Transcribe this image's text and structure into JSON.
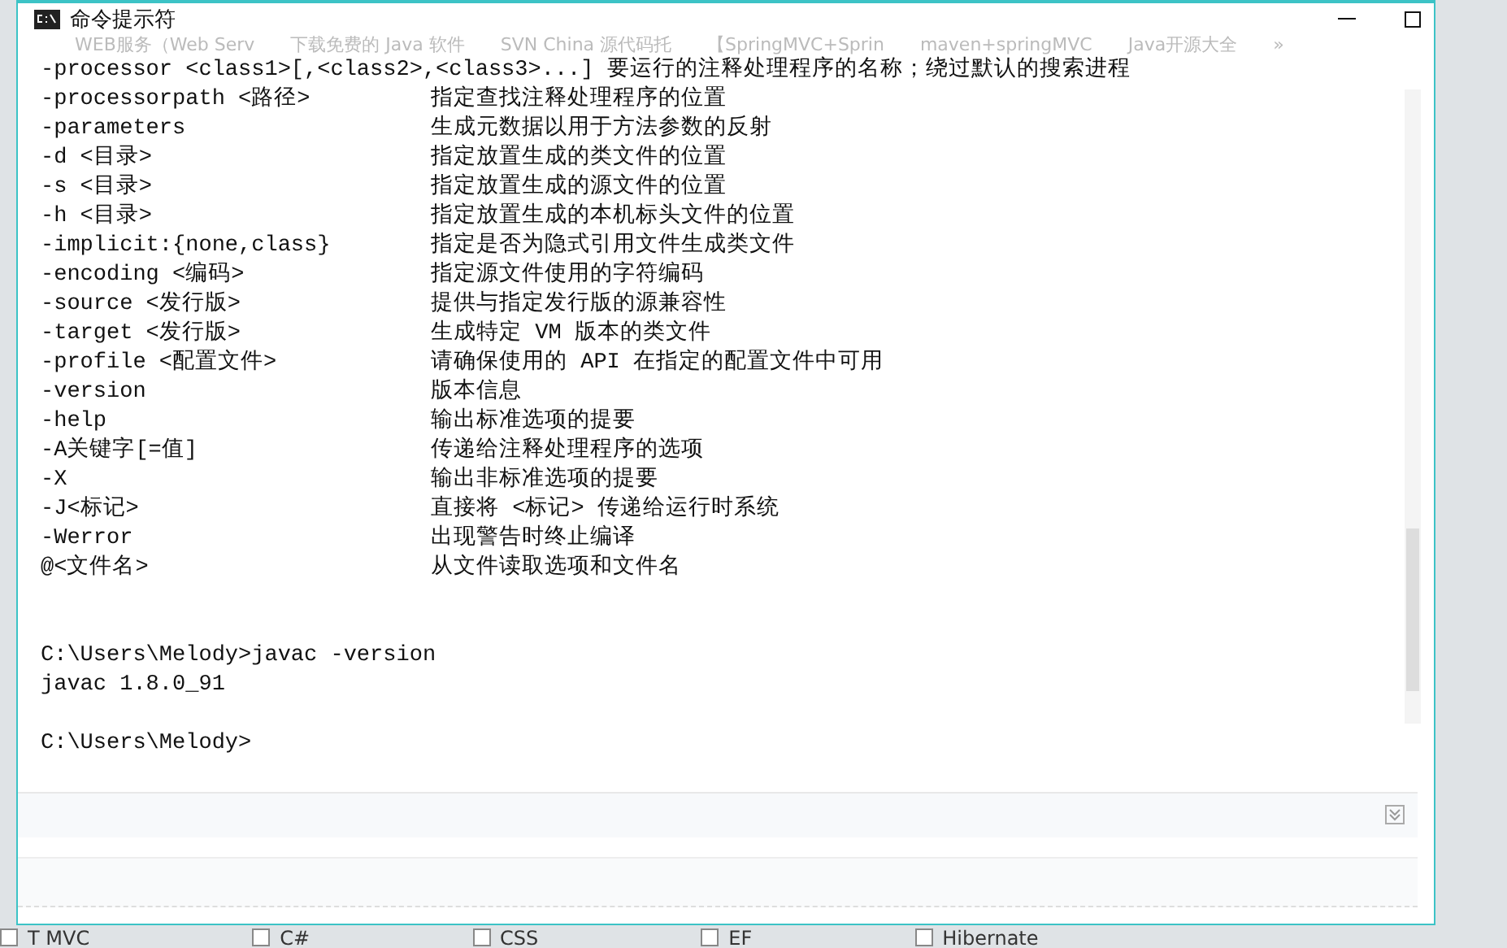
{
  "window": {
    "title": "命令提示符"
  },
  "bookmarks": [
    "WEB服务（Web Serv",
    "下载免费的 Java 软件",
    "SVN China 源代码托",
    "【SpringMVC+Sprin",
    "maven+springMVC",
    "Java开源大全",
    "»"
  ],
  "help_lines": [
    {
      "option": "-processor <class1>[,<class2>,<class3>...]",
      "description": "要运行的注释处理程序的名称；绕过默认的搜索进程"
    },
    {
      "option": "-processorpath <路径>",
      "description": "指定查找注释处理程序的位置"
    },
    {
      "option": "-parameters",
      "description": "生成元数据以用于方法参数的反射"
    },
    {
      "option": "-d <目录>",
      "description": "指定放置生成的类文件的位置"
    },
    {
      "option": "-s <目录>",
      "description": "指定放置生成的源文件的位置"
    },
    {
      "option": "-h <目录>",
      "description": "指定放置生成的本机标头文件的位置"
    },
    {
      "option": "-implicit:{none,class}",
      "description": "指定是否为隐式引用文件生成类文件"
    },
    {
      "option": "-encoding <编码>",
      "description": "指定源文件使用的字符编码"
    },
    {
      "option": "-source <发行版>",
      "description": "提供与指定发行版的源兼容性"
    },
    {
      "option": "-target <发行版>",
      "description": "生成特定 VM 版本的类文件"
    },
    {
      "option": "-profile <配置文件>",
      "description": "请确保使用的 API 在指定的配置文件中可用"
    },
    {
      "option": "-version",
      "description": "版本信息"
    },
    {
      "option": "-help",
      "description": "输出标准选项的提要"
    },
    {
      "option": "-A关键字[=值]",
      "description": "传递给注释处理程序的选项"
    },
    {
      "option": "-X",
      "description": "输出非标准选项的提要"
    },
    {
      "option": "-J<标记>",
      "description": "直接将 <标记> 传递给运行时系统"
    },
    {
      "option": "-Werror",
      "description": "出现警告时终止编译"
    },
    {
      "option": "@<文件名>",
      "description": "从文件读取选项和文件名"
    }
  ],
  "console_lines": [
    "C:\\Users\\Melody>javac -version",
    "javac 1.8.0_91"
  ],
  "prompt": "C:\\Users\\Melody>",
  "checkboxes": [
    {
      "label": "T MVC",
      "checked": false
    },
    {
      "label": "C#",
      "checked": false
    },
    {
      "label": "CSS",
      "checked": false
    },
    {
      "label": "EF",
      "checked": false
    },
    {
      "label": "Hibernate",
      "checked": false
    }
  ]
}
